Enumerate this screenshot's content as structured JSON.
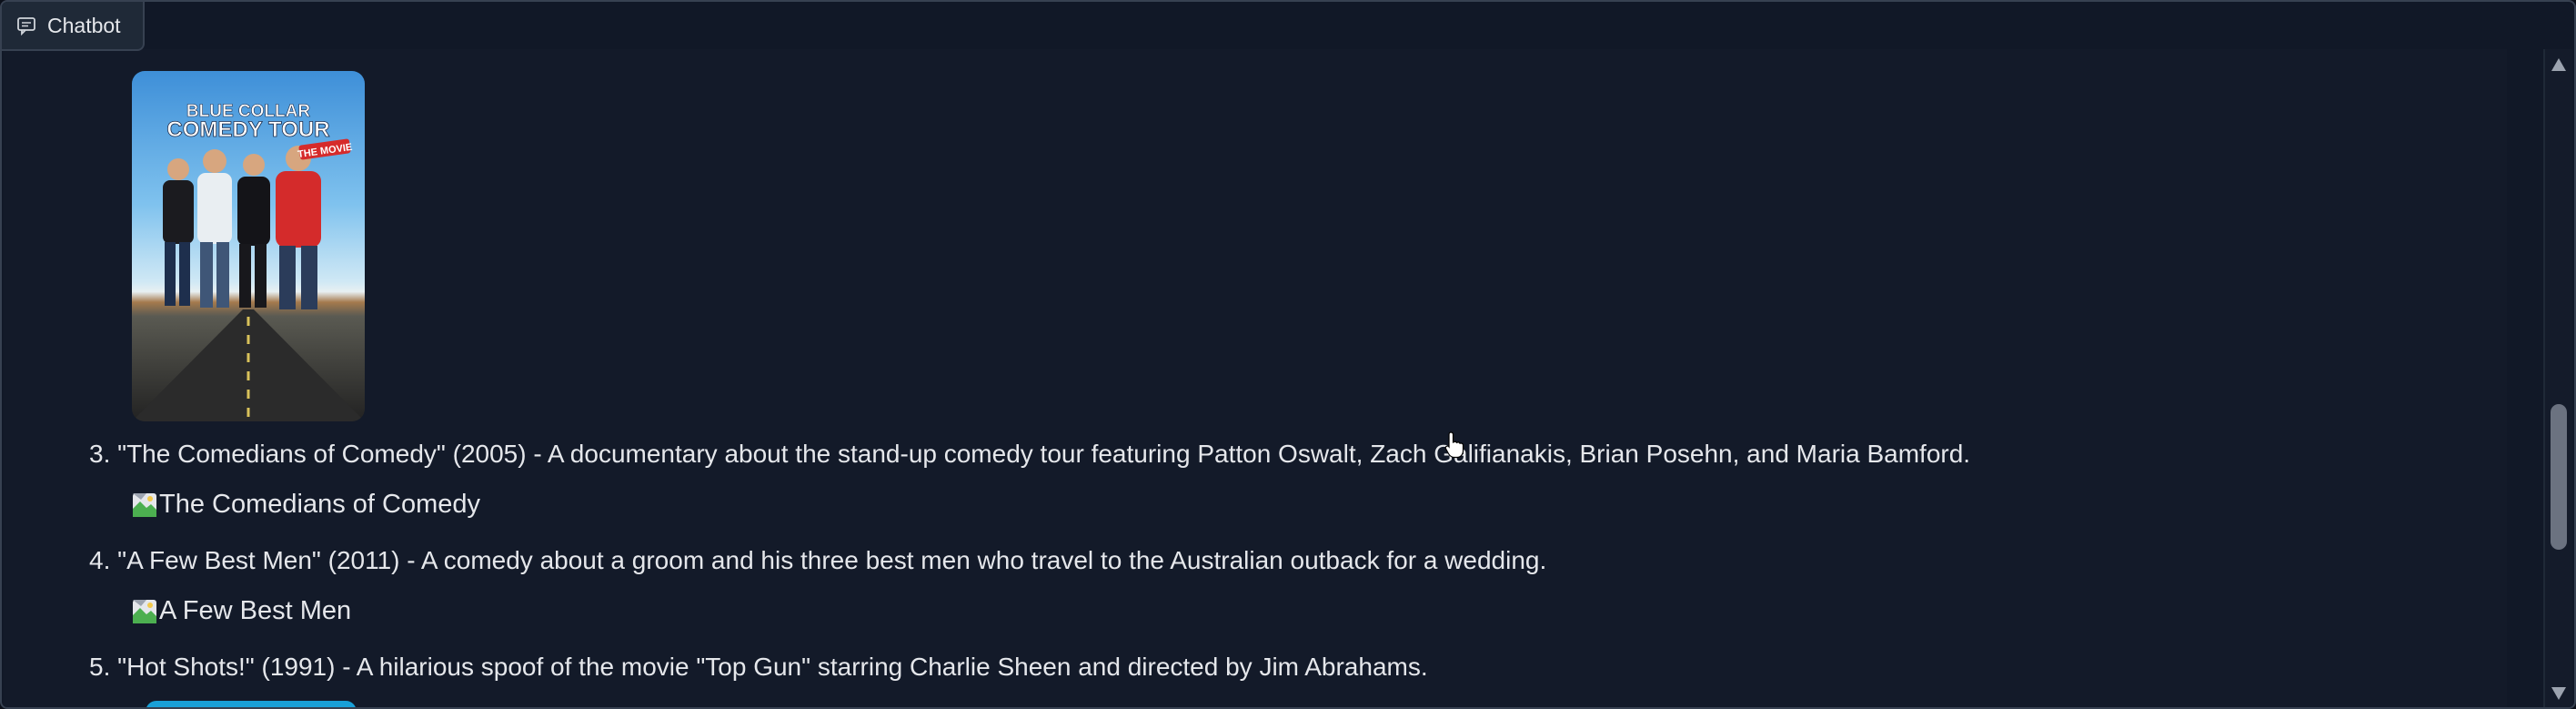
{
  "tab": {
    "label": "Chatbot",
    "icon": "chat-icon"
  },
  "poster": {
    "title_line1": "BLUE COLLAR",
    "title_line2": "COMEDY TOUR",
    "title_badge": "THE MOVIE"
  },
  "items": [
    {
      "text": "3. \"The Comedians of Comedy\" (2005) - A documentary about the stand-up comedy tour featuring Patton Oswalt, Zach Galifianakis, Brian Posehn, and Maria Bamford.",
      "image_alt": "The Comedians of Comedy"
    },
    {
      "text": "4. \"A Few Best Men\" (2011) - A comedy about a groom and his three best men who travel to the Australian outback for a wedding.",
      "image_alt": "A Few Best Men"
    },
    {
      "text": "5. \"Hot Shots!\" (1991) - A hilarious spoof of the movie \"Top Gun\" starring Charlie Sheen and directed by Jim Abrahams."
    }
  ],
  "colors": {
    "background": "#0b0f19",
    "panel": "#131a29",
    "text": "#e5e7eb",
    "border": "#374151"
  }
}
